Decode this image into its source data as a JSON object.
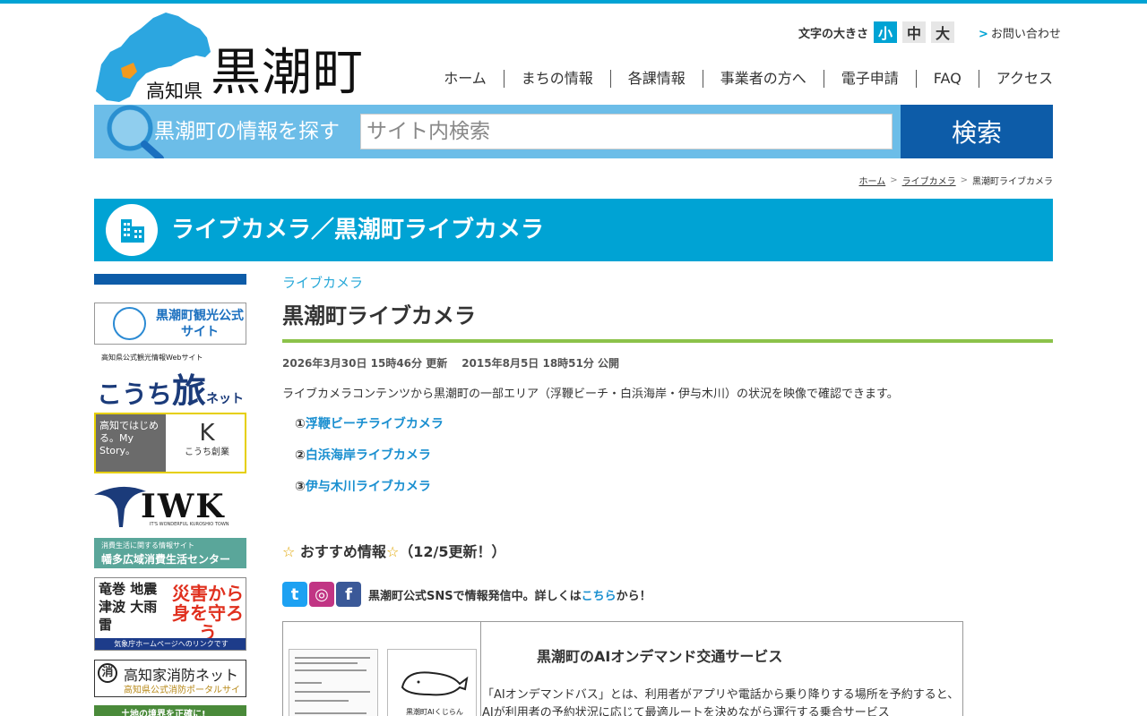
{
  "header": {
    "pref": "高知県",
    "town": "黒潮町",
    "fontsize_label": "文字の大きさ",
    "fontsize_options": [
      "小",
      "中",
      "大"
    ],
    "contact": "お問い合わせ",
    "nav": [
      "ホーム",
      "まちの情報",
      "各課情報",
      "事業者の方へ",
      "電子申請",
      "FAQ",
      "アクセス"
    ]
  },
  "search": {
    "label": "黒潮町の情報を探す",
    "placeholder": "サイト内検索",
    "button": "検索"
  },
  "breadcrumb": [
    "ホーム",
    "ライブカメラ",
    "黒潮町ライブカメラ"
  ],
  "title_band": "ライブカメラ／黒潮町ライブカメラ",
  "sidebar": {
    "b1": "黒潮町観光公式サイト",
    "b2_small": "高知県公式観光情報Webサイト",
    "b2_main": "こうち",
    "b2_tabi": "旅",
    "b2_net": "ネット",
    "b3_left": "高知ではじめる。My Story。",
    "b3_right": "こうち創業",
    "b4": "IWK",
    "b4_sub": "IT'S WONDERFUL KUROSHIO TOWN",
    "b5_small": "消費生活に関する情報サイト",
    "b5_main": "幡多広域消費生活センター",
    "b6_left": "竜巻 地震 津波 大雨 雷",
    "b6_right": "災害から身を守ろう",
    "b6_bottom": "気象庁ホームページへのリンクです",
    "b7_mark": "消",
    "b7_main": "高知家消防ネット",
    "b7_sub": "高知県公式消防ポータルサイト",
    "b8": "土地の境界を正確に!"
  },
  "main": {
    "category": "ライブカメラ",
    "title": "黒潮町ライブカメラ",
    "updated": "2026年3月30日 15時46分 更新",
    "published": "2015年8月5日 18時51分 公開",
    "description": "ライブカメラコンテンツから黒潮町の一部エリア（浮鞭ビーチ・白浜海岸・伊与木川）の状況を映像で確認できます。",
    "cameras": [
      {
        "num": "①",
        "label": "浮鞭ビーチライブカメラ"
      },
      {
        "num": "②",
        "label": "白浜海岸ライブカメラ"
      },
      {
        "num": "③",
        "label": "伊与木川ライブカメラ"
      }
    ],
    "osusume": "おすすめ情報",
    "osusume_date": "（12/5更新！）",
    "sns_text": "黒潮町公式SNSで情報発信中。詳しくは",
    "sns_link": "こちら",
    "sns_suffix": "から！",
    "info_title": "黒潮町のAIオンデマンド交通サービス",
    "info_body": "「AIオンデマンドバス」とは、利用者がアプリや電話から乗り降りする場所を予約すると、AIが利用者の予約状況に応じて最適ルートを決めながら運行する乗合サービス",
    "kujira_label": "黒潮町AIくじらん"
  },
  "colors": {
    "accent": "#00a3d4",
    "search_bg": "#6cbde8",
    "search_btn": "#0d5ca8",
    "green_rule": "#8cc24a",
    "link": "#1a8fd0"
  }
}
